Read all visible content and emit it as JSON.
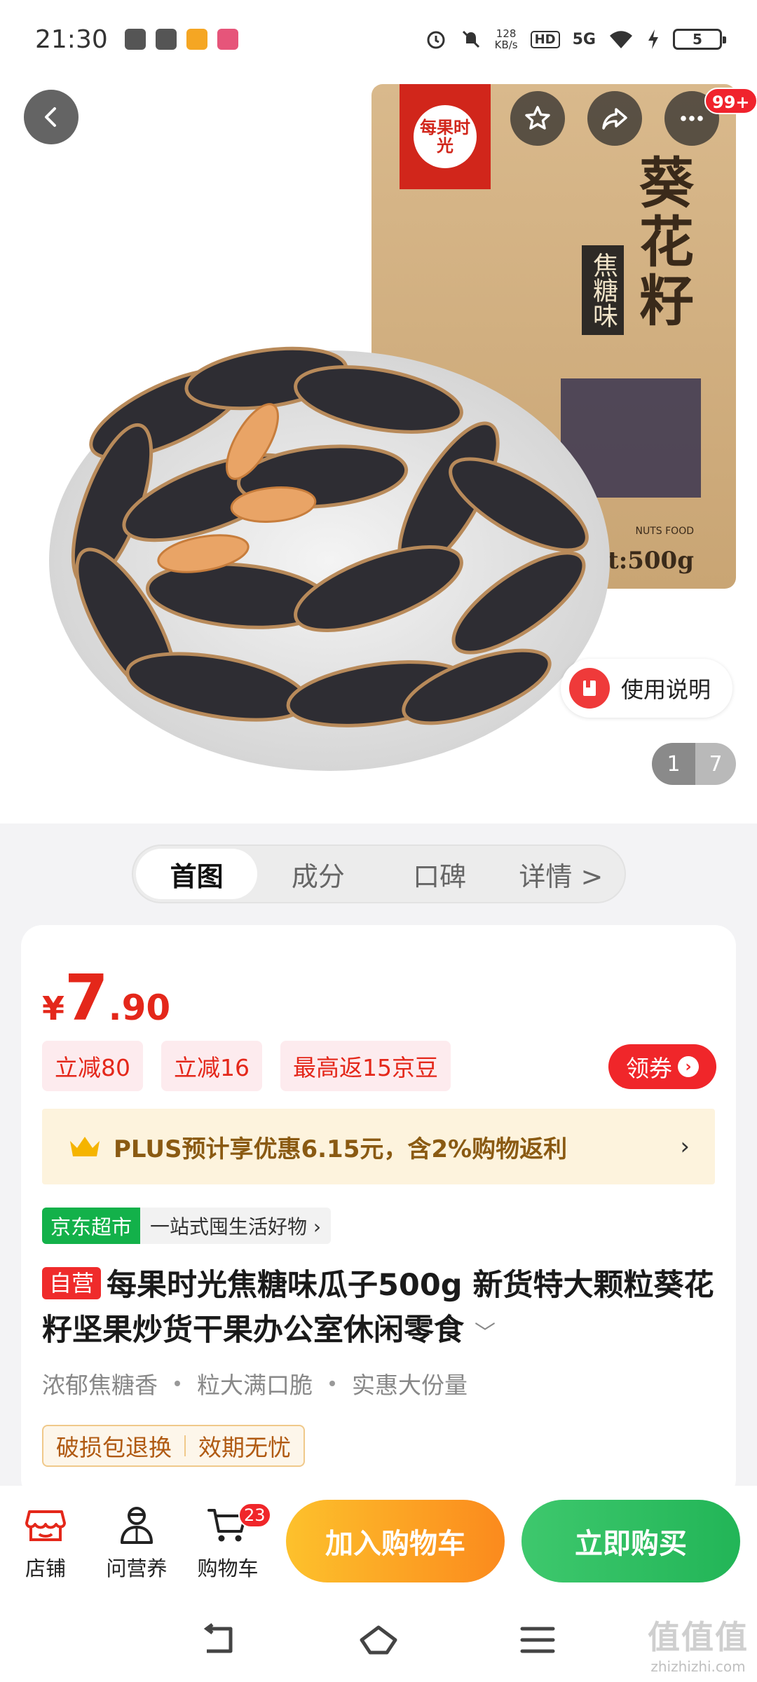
{
  "status_bar": {
    "time": "21:30",
    "net_speed_value": "128",
    "net_speed_unit": "KB/s",
    "hd": "HD",
    "network": "5G",
    "battery": "5",
    "icons": [
      "zhi-icon",
      "wechat-icon",
      "weibo-icon",
      "bilibili-icon",
      "alarm-icon",
      "mute-icon",
      "wifi-icon",
      "charging-icon"
    ]
  },
  "header": {
    "notification_badge": "99+",
    "icons": [
      "back-icon",
      "favorite-star-icon",
      "share-icon",
      "more-icon"
    ]
  },
  "product_image": {
    "bag_brand": "每果时光",
    "bag_title": "葵花籽",
    "bag_flavor": "焦糖味",
    "bag_weight": "t:500g",
    "bag_subtitle": "NUTS FOOD",
    "manual_label": "使用说明",
    "current_image": "1",
    "total_images": "7"
  },
  "tabs": [
    {
      "label": "首图",
      "active": true
    },
    {
      "label": "成分",
      "active": false
    },
    {
      "label": "口碑",
      "active": false
    },
    {
      "label": "详情 >",
      "active": false
    }
  ],
  "price": {
    "currency": "¥",
    "integer": "7",
    "decimal": ".90"
  },
  "promotions": [
    "立减80",
    "立减16",
    "最高返15京豆"
  ],
  "coupon_label": "领券",
  "plus": {
    "text": "PLUS预计享优惠6.15元，含2%购物返利",
    "chevron": "›"
  },
  "supermarket": {
    "tag": "京东超市",
    "slogan": "一站式囤生活好物 ›"
  },
  "product": {
    "self_operated_tag": "自营",
    "title": "每果时光焦糖味瓜子500g 新货特大颗粒葵花籽坚果炒货干果办公室休闲零食",
    "expand": "﹀"
  },
  "features": [
    "浓郁焦糖香",
    "粒大满口脆",
    "实惠大份量"
  ],
  "guarantees": [
    "破损包退换",
    "效期无忧"
  ],
  "bottom_bar": {
    "shop": "店铺",
    "service": "问营养",
    "cart": "购物车",
    "cart_count": "23",
    "add_to_cart": "加入购物车",
    "buy_now": "立即购买"
  },
  "watermark": {
    "big": "值值值",
    "small": "zhizhizhi.com"
  },
  "colors": {
    "price_red": "#e4271a",
    "coupon_red": "#f0262a",
    "buy_green": "#22b557",
    "cart_orange": "#fb8a1d",
    "supermarket_green": "#13b14a"
  }
}
